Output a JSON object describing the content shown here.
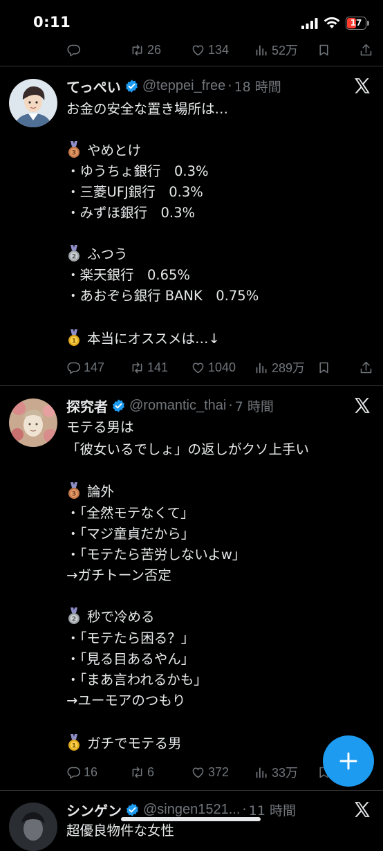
{
  "status_bar": {
    "time": "0:11",
    "battery": "17"
  },
  "top_actions": {
    "retweets": "26",
    "likes": "134",
    "views": "52万"
  },
  "tweets": [
    {
      "name": "てっぺい",
      "handle": "@teppei_free",
      "time": "18 時間",
      "lines": [
        "お金の安全な置き場所は…",
        "",
        "やめとけ",
        "・ゆうちょ銀行　0.3%",
        "・三菱UFJ銀行　0.3%",
        "・みずほ銀行　0.3%",
        "",
        "ふつう",
        "・楽天銀行　0.65%",
        "・あおぞら銀行 BANK　0.75%",
        "",
        "本当にオススメは…↓"
      ],
      "replies": "147",
      "retweets": "141",
      "likes": "1040",
      "views": "289万"
    },
    {
      "name": "探究者",
      "handle": "@romantic_thai",
      "time": "7 時間",
      "lines": [
        "モテる男は",
        "「彼女いるでしょ」の返しがクソ上手い",
        "",
        "論外",
        "・「全然モテなくて」",
        "・「マジ童貞だから」",
        "・「モテたら苦労しないよw」",
        "→ガチトーン否定",
        "",
        "秒で冷める",
        "・「モテたら困る？」",
        "・「見る目あるやん」",
        "・「まあ言われるかも」",
        "→ユーモアのつもり",
        "",
        "ガチでモテる男"
      ],
      "replies": "16",
      "retweets": "6",
      "likes": "372",
      "views": "33万"
    },
    {
      "name": "シンゲン",
      "handle": "@singen1521...",
      "time": "11 時間",
      "lines": [
        "超優良物件な女性"
      ]
    }
  ],
  "colors": {
    "background": "#000000",
    "text": "#e7e9ea",
    "muted": "#71767b",
    "accent": "#1d9bf0",
    "divider": "#2f3336"
  },
  "icons": [
    "signal-icon",
    "wifi-icon",
    "battery-icon",
    "reply-icon",
    "retweet-icon",
    "like-icon",
    "views-icon",
    "bookmark-icon",
    "share-icon",
    "verified-badge-icon",
    "x-logo-icon",
    "bronze-medal-icon",
    "silver-medal-icon",
    "gold-medal-icon",
    "plus-icon"
  ]
}
